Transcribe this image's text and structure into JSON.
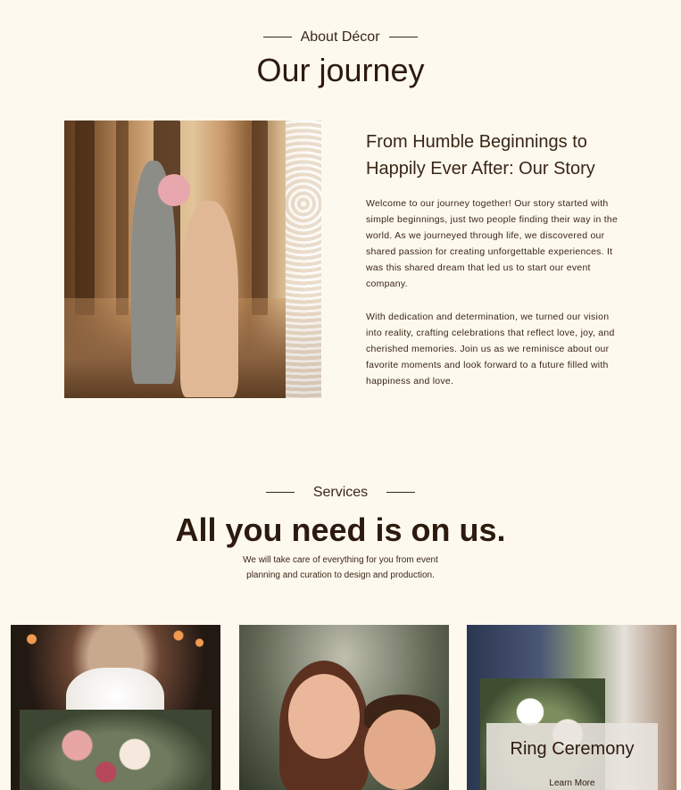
{
  "about": {
    "eyebrow": "About Décor",
    "title": "Our journey",
    "story_title": "From Humble Beginnings to Happily Ever After: Our Story",
    "paragraphs": [
      "Welcome to our journey together! Our story started with simple beginnings, just two people finding their way in the world. As we journeyed through life, we discovered our shared passion for creating unforgettable experiences. It was this shared dream that led us to start our event company.",
      "With dedication and determination, we turned our vision into reality, crafting celebrations that reflect love, joy, and cherished memories. Join us as we reminisce about our favorite moments and look forward to a future filled with happiness and love."
    ]
  },
  "services": {
    "eyebrow": "Services",
    "title": "All you need is on us.",
    "description": "We will take care of  everything for you from event planning and curation to design and production.",
    "cards": [
      {
        "title": "Ring Ceremony",
        "link_label": "Learn More"
      }
    ]
  },
  "colors": {
    "background": "#fef9ef",
    "text": "#2d1a0e"
  }
}
